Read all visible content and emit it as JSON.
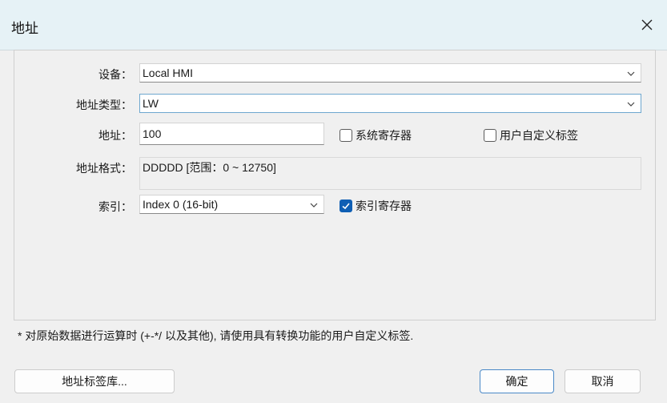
{
  "window": {
    "title": "地址"
  },
  "form": {
    "device_label": "设备：",
    "device_value": "Local HMI",
    "address_type_label": "地址类型：",
    "address_type_value": "LW",
    "address_label": "地址：",
    "address_value": "100",
    "system_register_label": "系统寄存器",
    "system_register_checked": false,
    "user_tag_label": "用户自定义标签",
    "user_tag_checked": false,
    "format_label": "地址格式：",
    "format_value": "DDDDD [范围：0 ~ 12750]",
    "index_label": "索引：",
    "index_value": "Index 0 (16-bit)",
    "index_register_label": "索引寄存器",
    "index_register_checked": true
  },
  "note": "* 对原始数据进行运算时 (+-*/ 以及其他), 请使用具有转换功能的用户自定义标签.",
  "buttons": {
    "tag_library": "地址标签库...",
    "ok": "确定",
    "cancel": "取消"
  },
  "icons": {
    "close": "close-icon",
    "dropdown": "chevron-down-icon",
    "check": "checkmark-icon"
  },
  "colors": {
    "titlebar": "#e6f2f6",
    "accent": "#0f5fb4"
  }
}
